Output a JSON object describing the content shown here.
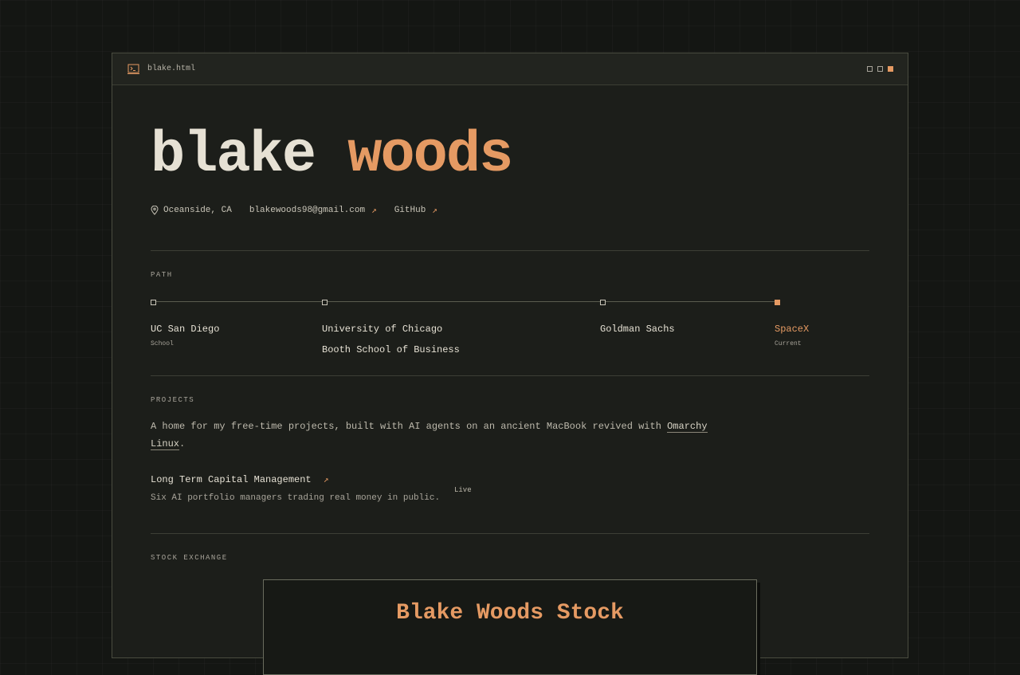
{
  "window": {
    "filename": "blake.html"
  },
  "profile": {
    "first_name": "blake",
    "last_name": "woods",
    "location": "Oceanside, CA",
    "email": "blakewoods98@gmail.com",
    "github": "GitHub",
    "link_arrow": "↗"
  },
  "path": {
    "label": "PATH",
    "items": [
      {
        "title": "UC San Diego",
        "sub": "School"
      },
      {
        "title": "University of Chicago",
        "title2": "Booth School of Business"
      },
      {
        "title": "Goldman Sachs"
      },
      {
        "title": "SpaceX",
        "sub": "Current"
      }
    ]
  },
  "projects": {
    "label": "PROJECTS",
    "intro": "A home for my free-time projects, built with AI agents on an ancient MacBook revived with",
    "intro_link": "Omarchy Linux",
    "intro_end": ".",
    "items": [
      {
        "title": "Long Term Capital Management",
        "description": "Six AI portfolio managers trading real money in public.",
        "status": "Live"
      }
    ]
  },
  "stock_exchange": {
    "label": "STOCK EXCHANGE",
    "card_title": "Blake Woods Stock"
  },
  "colors": {
    "accent": "#e59a63",
    "background": "#1c1e1a",
    "text": "#e6e1d4"
  },
  "icons": {
    "terminal": "terminal-icon",
    "location": "map-pin-icon",
    "external": "external-link-icon"
  }
}
